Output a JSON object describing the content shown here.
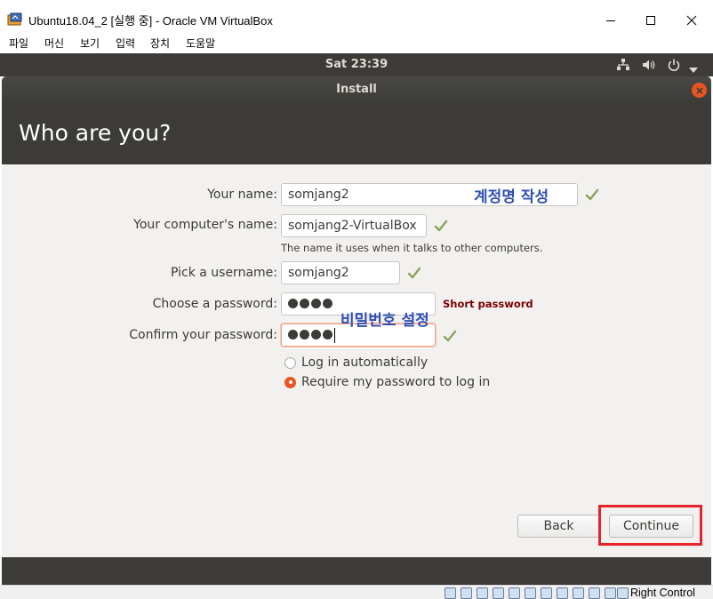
{
  "window": {
    "title": "Ubuntu18.04_2 [실행 중] - Oracle VM VirtualBox"
  },
  "menu": {
    "items": [
      "파일",
      "머신",
      "보기",
      "입력",
      "장치",
      "도움말"
    ]
  },
  "panel": {
    "clock": "Sat 23:39"
  },
  "installer": {
    "title": "Install",
    "heading": "Who are you?",
    "fields": {
      "name": {
        "label": "Your name:",
        "value": "somjang2"
      },
      "computer": {
        "label": "Your computer's name:",
        "value": "somjang2-VirtualBox",
        "hint": "The name it uses when it talks to other computers."
      },
      "username": {
        "label": "Pick a username:",
        "value": "somjang2"
      },
      "password": {
        "label": "Choose a password:",
        "dots": 4,
        "warning": "Short password"
      },
      "confirm": {
        "label": "Confirm your password:",
        "dots": 4
      }
    },
    "options": {
      "auto_login": "Log in automatically",
      "require_password": "Require my password to log in",
      "selected": "require_password"
    },
    "buttons": {
      "back": "Back",
      "continue": "Continue"
    }
  },
  "annotations": {
    "account_note": "계정명 작성",
    "password_note": "비밀번호 설정"
  },
  "statusbar": {
    "host_key": "Right Control"
  },
  "colors": {
    "accent": "#e95420",
    "panel": "#3c3b37",
    "check": "#87a556",
    "annotation": "#2e4fb5",
    "highlight": "#e8232a"
  }
}
